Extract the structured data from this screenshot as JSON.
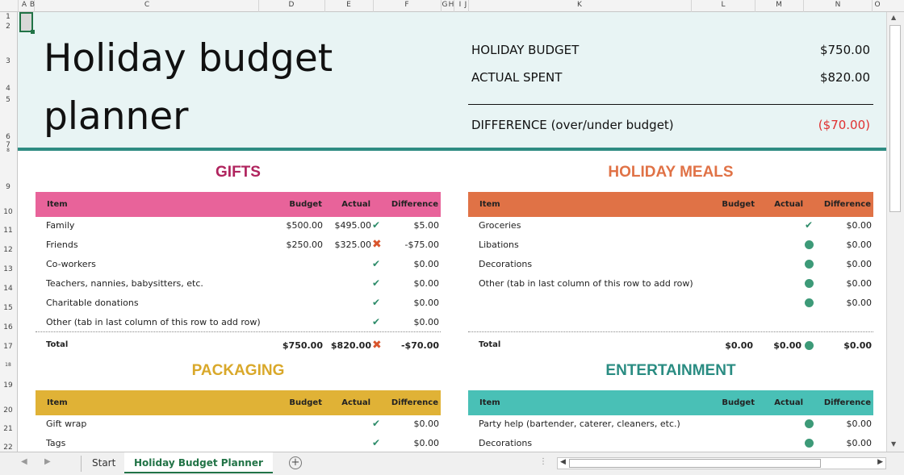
{
  "colhdr": [
    "A",
    "B",
    "C",
    "D",
    "E",
    "F",
    "G",
    "H",
    "I",
    "J",
    "K",
    "L",
    "M",
    "N",
    "O"
  ],
  "rows": [
    "1",
    "2",
    "3",
    "4",
    "5",
    "6",
    "7",
    "8",
    "9",
    "10",
    "11",
    "12",
    "13",
    "14",
    "15",
    "16",
    "17",
    "18",
    "19",
    "20",
    "21",
    "22"
  ],
  "title": {
    "line1": "Holiday budget",
    "line2": "planner"
  },
  "summary": {
    "budget_label": "HOLIDAY BUDGET",
    "budget_value": "$750.00",
    "actual_label": "ACTUAL SPENT",
    "actual_value": "$820.00",
    "diff_label": "DIFFERENCE",
    "diff_sub": "(over/under budget)",
    "diff_value": "($70.00)"
  },
  "headers": {
    "item": "Item",
    "budget": "Budget",
    "actual": "Actual",
    "difference": "Difference"
  },
  "gifts": {
    "title": "GIFTS",
    "rows": [
      {
        "item": "Family",
        "budget": "$500.00",
        "actual": "$495.00",
        "diff": "$5.00"
      },
      {
        "item": "Friends",
        "budget": "$250.00",
        "actual": "$325.00",
        "diff": "-$75.00"
      },
      {
        "item": "Co-workers",
        "budget": "",
        "actual": "",
        "diff": "$0.00"
      },
      {
        "item": "Teachers, nannies, babysitters, etc.",
        "budget": "",
        "actual": "",
        "diff": "$0.00"
      },
      {
        "item": "Charitable donations",
        "budget": "",
        "actual": "",
        "diff": "$0.00"
      },
      {
        "item": "Other (tab in last column of this row to add row)",
        "budget": "",
        "actual": "",
        "diff": "$0.00"
      }
    ],
    "total": {
      "label": "Total",
      "budget": "$750.00",
      "actual": "$820.00",
      "diff": "-$70.00"
    }
  },
  "meals": {
    "title": "HOLIDAY MEALS",
    "rows": [
      {
        "item": "Groceries",
        "diff": "$0.00"
      },
      {
        "item": "Libations",
        "diff": "$0.00"
      },
      {
        "item": "Decorations",
        "diff": "$0.00"
      },
      {
        "item": "Other (tab in last column of this row to add row)",
        "diff": "$0.00"
      },
      {
        "item": "",
        "diff": "$0.00"
      }
    ],
    "total": {
      "label": "Total",
      "budget": "$0.00",
      "actual": "$0.00",
      "diff": "$0.00"
    }
  },
  "packaging": {
    "title": "PACKAGING",
    "rows": [
      {
        "item": "Gift wrap",
        "diff": "$0.00"
      },
      {
        "item": "Tags",
        "diff": "$0.00"
      }
    ]
  },
  "entertainment": {
    "title": "ENTERTAINMENT",
    "rows": [
      {
        "item": "Party help (bartender, caterer, cleaners, etc.)",
        "diff": "$0.00"
      },
      {
        "item": "Decorations",
        "diff": "$0.00"
      }
    ]
  },
  "tabs": [
    "Start",
    "Holiday Budget Planner"
  ],
  "colors": {
    "gifts": "#e8639a",
    "meals": "#e07246",
    "packaging": "#e0b236",
    "entertainment": "#49c0b6",
    "accent": "#2e8c82",
    "negative": "#e03030"
  }
}
